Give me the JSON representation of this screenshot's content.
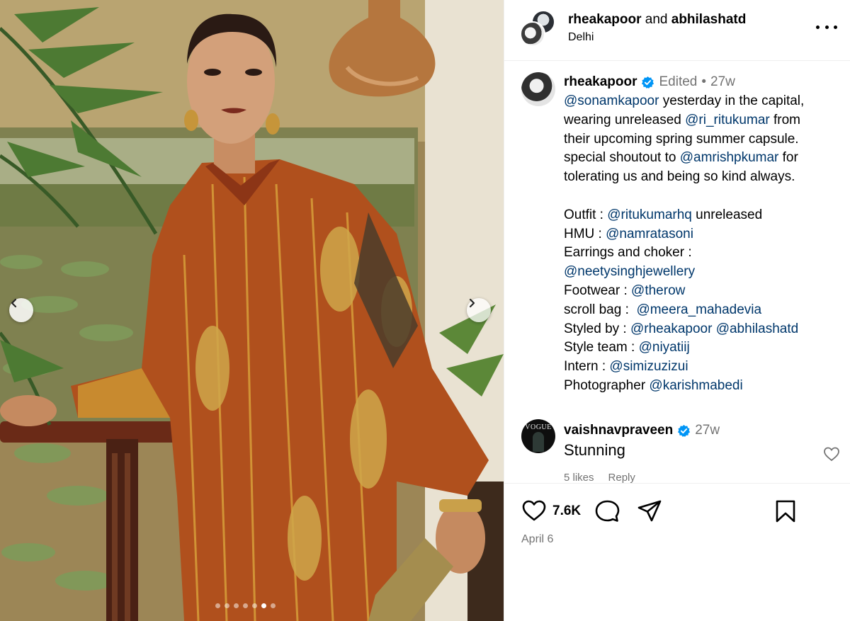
{
  "photo": {
    "prev_icon": "chevron-left-icon",
    "next_icon": "chevron-right-icon",
    "carousel": {
      "total": 7,
      "active_index": 5
    }
  },
  "header": {
    "user1": "rheakapoor",
    "and": " and ",
    "user2": "abhilashatd",
    "location": "Delhi",
    "more_icon": "more-horizontal-icon"
  },
  "caption": {
    "username": "rheakapoor",
    "edited": "Edited",
    "separator": "•",
    "time": "27w",
    "lines": [
      [
        {
          "t": "@sonamkapoor",
          "m": true
        },
        {
          "t": " yesterday in the capital,",
          "m": false
        }
      ],
      [
        {
          "t": "wearing unreleased ",
          "m": false
        },
        {
          "t": "@ri_ritukumar",
          "m": true
        },
        {
          "t": " from",
          "m": false
        }
      ],
      [
        {
          "t": "their upcoming spring summer capsule.",
          "m": false
        }
      ],
      [
        {
          "t": "special shoutout to ",
          "m": false
        },
        {
          "t": "@amrishpkumar",
          "m": true
        },
        {
          "t": " for",
          "m": false
        }
      ],
      [
        {
          "t": "tolerating us and being so kind always.",
          "m": false
        }
      ],
      [],
      [
        {
          "t": "Outfit : ",
          "m": false
        },
        {
          "t": "@ritukumarhq",
          "m": true
        },
        {
          "t": " unreleased",
          "m": false
        }
      ],
      [
        {
          "t": "HMU : ",
          "m": false
        },
        {
          "t": "@namratasoni",
          "m": true
        }
      ],
      [
        {
          "t": "Earrings and choker :",
          "m": false
        }
      ],
      [
        {
          "t": "@neetysinghjewellery",
          "m": true
        }
      ],
      [
        {
          "t": "Footwear : ",
          "m": false
        },
        {
          "t": "@therow",
          "m": true
        }
      ],
      [
        {
          "t": "scroll bag :  ",
          "m": false
        },
        {
          "t": "@meera_mahadevia",
          "m": true
        }
      ],
      [
        {
          "t": "Styled by : ",
          "m": false
        },
        {
          "t": "@rheakapoor",
          "m": true
        },
        {
          "t": " ",
          "m": false
        },
        {
          "t": "@abhilashatd",
          "m": true
        }
      ],
      [
        {
          "t": "Style team : ",
          "m": false
        },
        {
          "t": "@niyatiij",
          "m": true
        }
      ],
      [
        {
          "t": "Intern : ",
          "m": false
        },
        {
          "t": "@simizuzizui",
          "m": true
        }
      ],
      [
        {
          "t": "Photographer ",
          "m": false
        },
        {
          "t": "@karishmabedi",
          "m": true
        }
      ]
    ]
  },
  "comment": {
    "avatar_text": "VOGUE",
    "username": "vaishnavpraveen",
    "time": "27w",
    "text": "Stunning",
    "likes": "5 likes",
    "reply": "Reply"
  },
  "actions": {
    "like_icon": "heart-icon",
    "like_count": "7.6K",
    "comment_icon": "comment-icon",
    "share_icon": "send-icon",
    "save_icon": "bookmark-icon",
    "date": "April 6"
  },
  "colors": {
    "mention": "#00376b",
    "verified": "#0095f6",
    "muted": "#737373",
    "border": "#efefef"
  }
}
